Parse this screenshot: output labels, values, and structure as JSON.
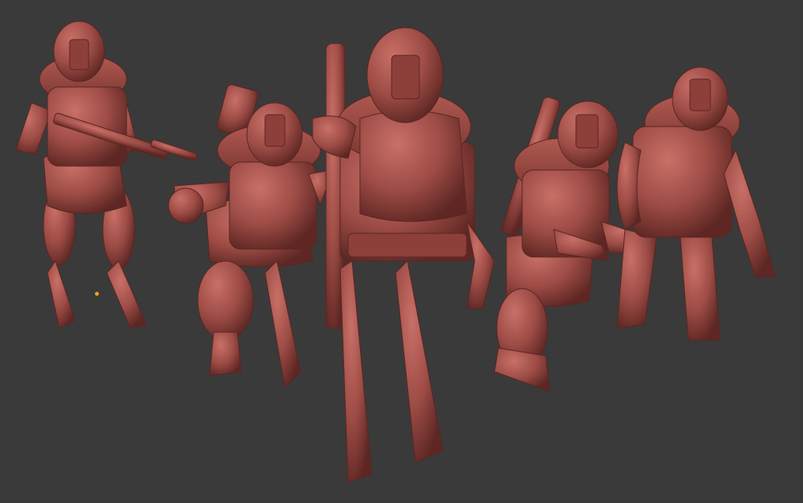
{
  "viewport": {
    "background_color": "#3a3a3a",
    "model_material_color": "#9e4c46",
    "model_shadow_color": "#5e2723",
    "model_highlight_color": "#c06a62",
    "origin_marker_color": "#f0a020"
  },
  "scene": {
    "description_icon": "sculpt-render",
    "figure_count": 5,
    "figures": [
      {
        "name": "rifle-soldier"
      },
      {
        "name": "clawed-soldier"
      },
      {
        "name": "tall-backpack-soldier"
      },
      {
        "name": "crouching-rifle-soldier"
      },
      {
        "name": "reaching-soldier"
      }
    ]
  }
}
